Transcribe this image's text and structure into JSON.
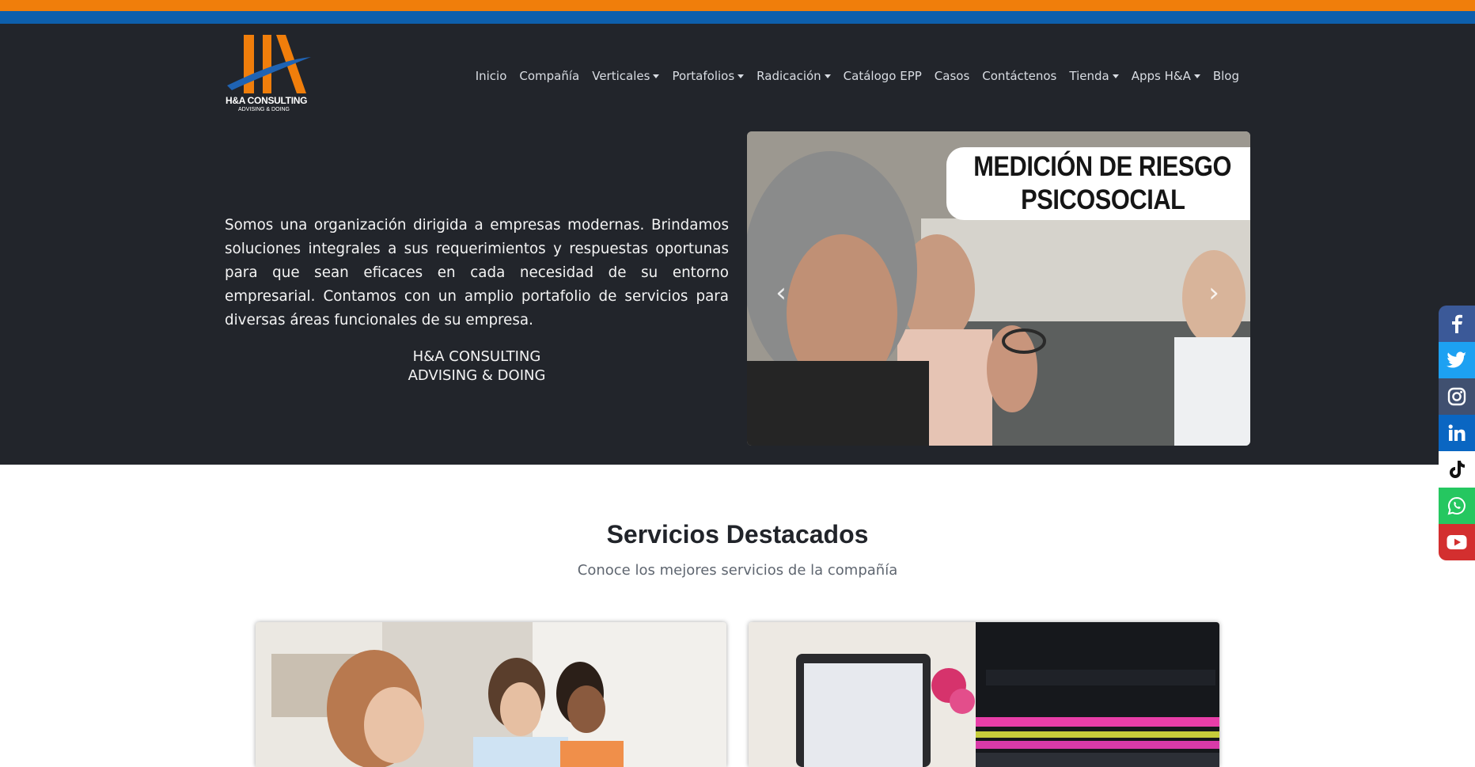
{
  "brand": {
    "logo_title": "H&A CONSULTING",
    "logo_subtitle": "ADVISING & DOING"
  },
  "colors": {
    "top_bar_orange": "#f07e0b",
    "top_bar_blue": "#0d5fac",
    "hero_background": "#22252b",
    "facebook": "#3b5998",
    "twitter": "#1da1f2",
    "instagram": "#405070",
    "linkedin": "#0a66c2",
    "tiktok": "#ffffff",
    "whatsapp": "#25c760",
    "youtube": "#d32f2f"
  },
  "nav": {
    "items": [
      {
        "label": "Inicio",
        "dropdown": false
      },
      {
        "label": "Compañía",
        "dropdown": false
      },
      {
        "label": "Verticales",
        "dropdown": true
      },
      {
        "label": "Portafolios",
        "dropdown": true
      },
      {
        "label": "Radicación",
        "dropdown": true
      },
      {
        "label": "Catálogo EPP",
        "dropdown": false
      },
      {
        "label": "Casos",
        "dropdown": false
      },
      {
        "label": "Contáctenos",
        "dropdown": false
      },
      {
        "label": "Tienda",
        "dropdown": true
      },
      {
        "label": "Apps H&A",
        "dropdown": true
      },
      {
        "label": "Blog",
        "dropdown": false
      }
    ]
  },
  "hero": {
    "intro": "Somos una organización dirigida a empresas modernas. Brindamos soluciones integrales a sus requerimientos y respuestas oportunas para que sean eficaces en cada necesidad de su entorno empresarial. Contamos con un amplio portafolio de servicios para diversas áreas funcionales de su empresa.",
    "brand_line_1": "H&A CONSULTING",
    "brand_line_2": "ADVISING & DOING"
  },
  "carousel": {
    "slide_title_line_1": "MEDICIÓN DE RIESGO",
    "slide_title_line_2": "PSICOSOCIAL",
    "prev_icon": "chevron-left-icon",
    "next_icon": "chevron-right-icon"
  },
  "services": {
    "title": "Servicios Destacados",
    "subtitle": "Conoce los mejores servicios de la compañía"
  },
  "social": [
    {
      "name": "facebook-icon"
    },
    {
      "name": "twitter-icon"
    },
    {
      "name": "instagram-icon"
    },
    {
      "name": "linkedin-icon"
    },
    {
      "name": "tiktok-icon"
    },
    {
      "name": "whatsapp-icon"
    },
    {
      "name": "youtube-icon"
    }
  ]
}
